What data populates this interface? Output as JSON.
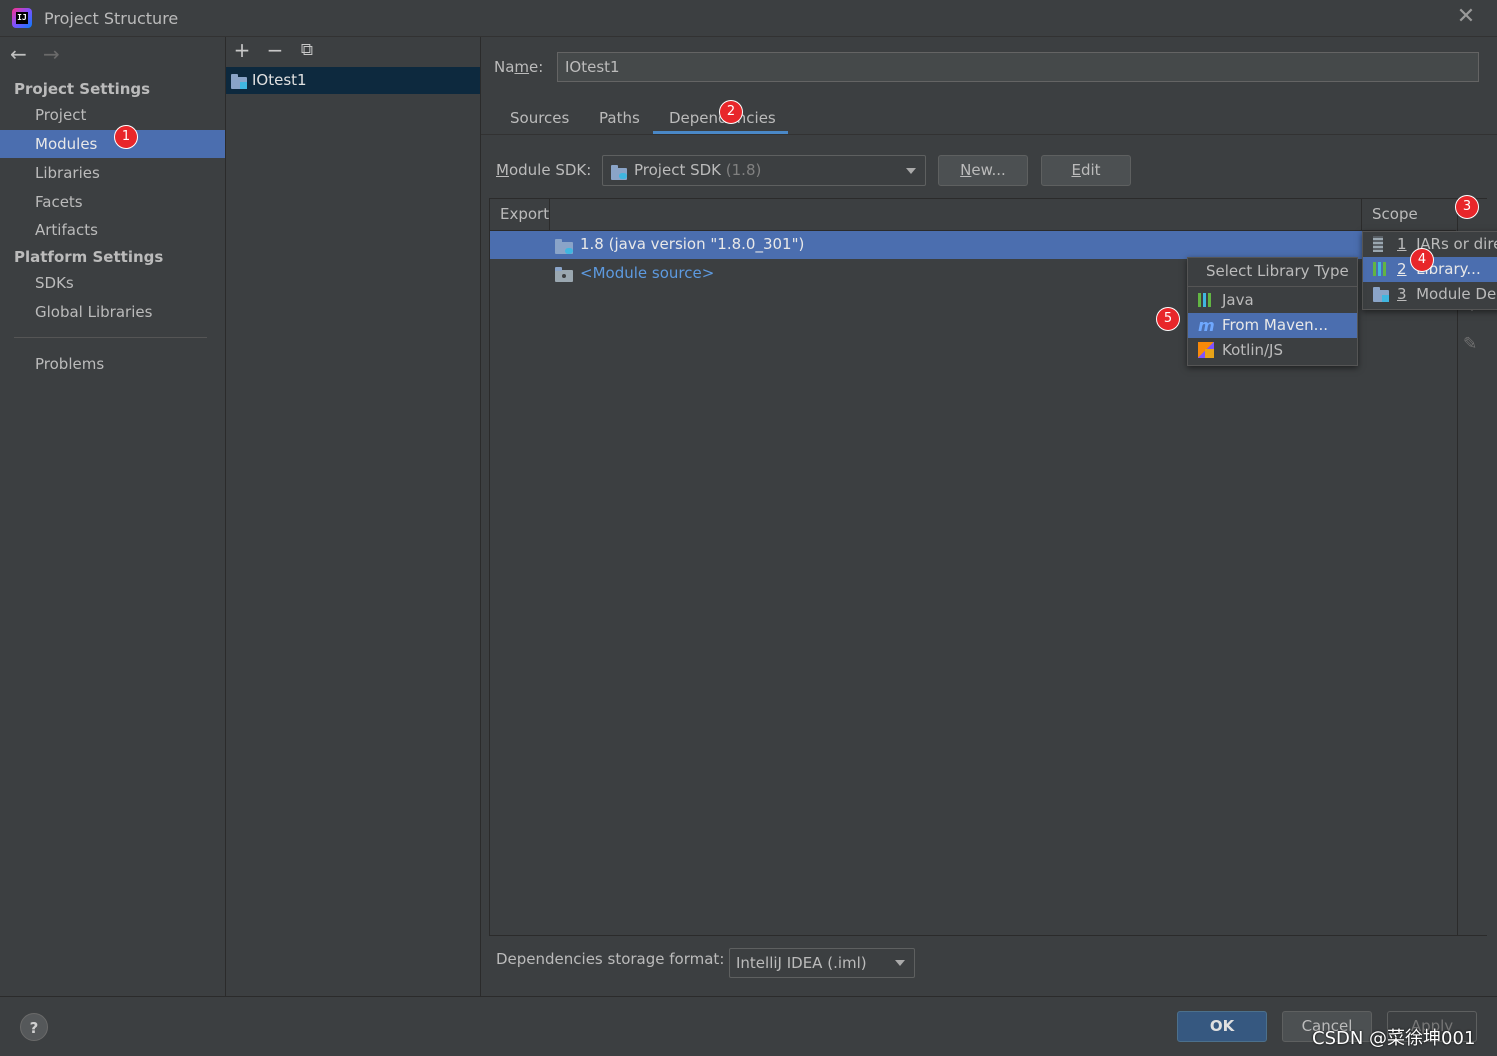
{
  "window": {
    "title": "Project Structure",
    "logo_text": "IJ"
  },
  "icons": {
    "back": "←",
    "forward": "→",
    "add": "+",
    "remove": "−",
    "copy": "⧉",
    "close": "✕"
  },
  "sidebar": {
    "project_settings_heading": "Project Settings",
    "project_items": [
      "Project",
      "Modules",
      "Libraries",
      "Facets",
      "Artifacts"
    ],
    "selected": "Modules",
    "platform_settings_heading": "Platform Settings",
    "platform_items": [
      "SDKs",
      "Global Libraries"
    ],
    "problems": "Problems"
  },
  "modules": {
    "items": [
      "IOtest1"
    ]
  },
  "module": {
    "name_label_pre": "Na",
    "name_label_u": "m",
    "name_label_post": "e:",
    "name_value": "IOtest1",
    "tabs": [
      "Sources",
      "Paths",
      "Dependencies"
    ],
    "active_tab": "Dependencies"
  },
  "sdk": {
    "label_u": "M",
    "label_rest": "odule SDK:",
    "value": "Project SDK",
    "version": "(1.8)",
    "new_u": "N",
    "new_rest": "ew...",
    "edit_u": "E",
    "edit_rest": "dit"
  },
  "table": {
    "headers": {
      "export": "Export",
      "scope": "Scope"
    },
    "rows": [
      {
        "text": "1.8 (java version \"1.8.0_301\")",
        "selected": true
      },
      {
        "text": "<Module source>",
        "selected": false
      }
    ]
  },
  "add_menu": {
    "items": [
      {
        "num": "1",
        "label": "JARs or dire",
        "icon": "jar-icon"
      },
      {
        "num": "2",
        "label": "Library...",
        "icon": "library-icon",
        "selected": true
      },
      {
        "num": "3",
        "label": "Module De",
        "icon": "module-icon"
      }
    ]
  },
  "library_type_menu": {
    "title": "Select Library Type",
    "items": [
      {
        "label": "Java",
        "icon": "java-library-icon"
      },
      {
        "label": "From Maven...",
        "icon": "maven-icon",
        "selected": true
      },
      {
        "label": "Kotlin/JS",
        "icon": "kotlin-js-icon"
      }
    ]
  },
  "footer": {
    "storage_label": "Dependencies storage format:",
    "storage_value": "IntelliJ IDEA (.iml)",
    "help": "?",
    "ok": "OK",
    "cancel": "Cancel",
    "apply": "Apply"
  },
  "annotations": {
    "steps": [
      "1",
      "2",
      "3",
      "4",
      "5"
    ],
    "color": "#e8262a"
  },
  "watermark": "CSDN @菜徐坤001",
  "colors": {
    "selection": "#4b6eaf",
    "accent": "#4a88c7",
    "background": "#3c3f41",
    "link": "#5d9ae0"
  }
}
